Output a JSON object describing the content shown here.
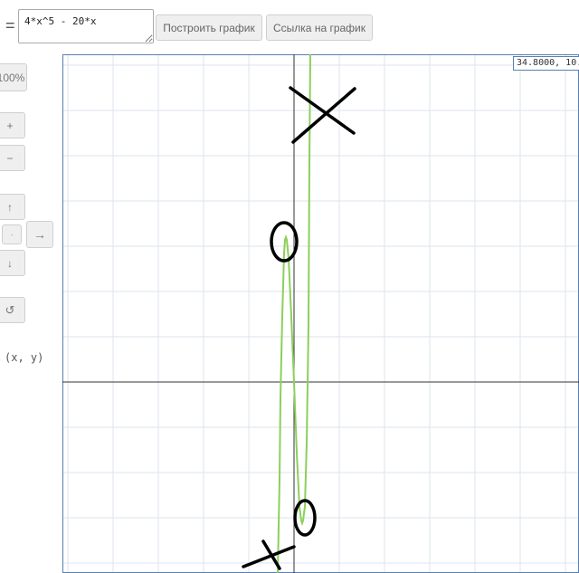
{
  "input": {
    "equals_sign": "=",
    "formula": "4*x^5 - 20*x"
  },
  "toolbar": {
    "plot_label": "Построить график",
    "link_label": "Ссылка на график"
  },
  "controls": {
    "zoom_reset_label": "100%",
    "zoom_in_label": "+",
    "zoom_out_label": "−",
    "pan_up_label": "↑",
    "pan_center_label": "·",
    "pan_right_label": "→",
    "pan_down_label": "↓",
    "reset_label": "↺",
    "coord_label": "(x, y)"
  },
  "graph": {
    "cursor_readout": "34.8000, 10.",
    "curve_color": "#8dcf5a",
    "axis_color": "#333333",
    "grid_color": "#dde3ee",
    "annotation_color": "#000000"
  }
}
